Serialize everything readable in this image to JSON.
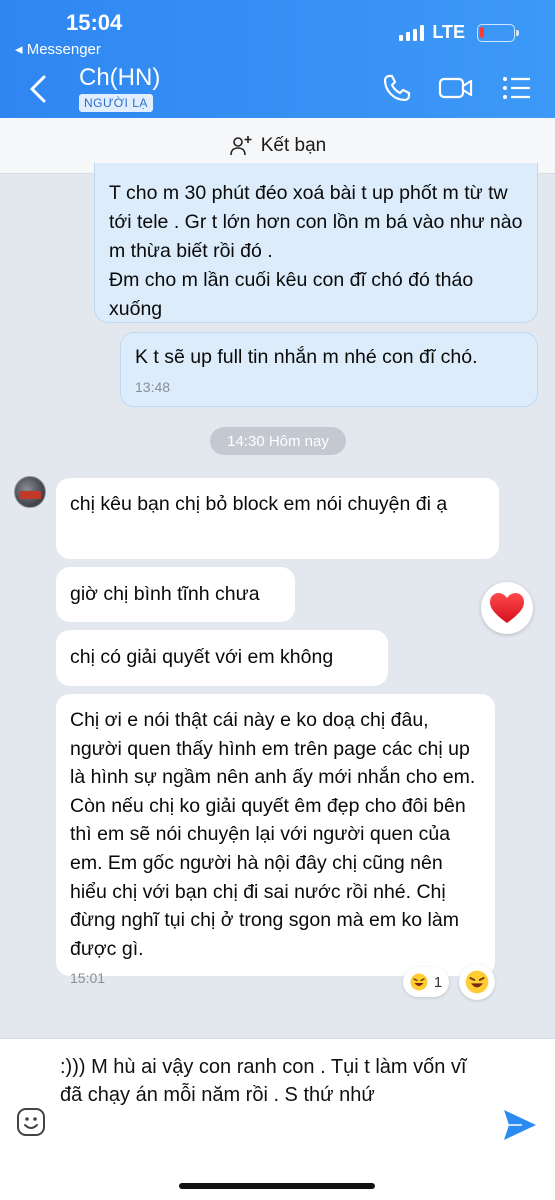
{
  "status_bar": {
    "time": "15:04",
    "back_app": "◂ Messenger",
    "network": "LTE",
    "battery_level": 0.1
  },
  "header": {
    "contact_name": "Ch(HN)",
    "badge": "NGƯỜI LẠ"
  },
  "add_friend": {
    "label": "Kết bạn"
  },
  "messages": [
    {
      "dir": "out",
      "text": "T cho m 30 phút đéo xoá bài t up phốt m từ tw tới tele . Gr t lớn hơn con lồn m bá vào như nào m thừa biết rồi đó .\nĐm cho m lần cuối kêu con đĩ chó đó tháo xuống"
    },
    {
      "dir": "out",
      "text": "K t sẽ up full tin nhắn m nhé con đĩ chó.",
      "time": "13:48"
    },
    {
      "dir": "in",
      "text": "chị kêu bạn chị bỏ block em nói chuyện đi ạ"
    },
    {
      "dir": "in",
      "text": "giờ chị bình tĩnh chưa"
    },
    {
      "dir": "in",
      "text": "chị có giải quyết với em không"
    },
    {
      "dir": "in",
      "text": "Chị ơi e nói thật cái này e ko doạ chị đâu, người quen thấy hình em trên page các chị up là hình sự ngầm nên anh ấy mới nhắn cho em. Còn nếu chị ko giải quyết êm đẹp cho đôi bên thì em sẽ nói chuyện lại với người quen của em. Em gốc người hà nội đây chị cũng nên hiểu chị với bạn chị đi sai nước rồi nhé. Chị đừng nghĩ tụi chị ở trong sgon mà em ko làm được gì.",
      "time": "15:01"
    }
  ],
  "separator": {
    "label": "14:30 Hôm nay"
  },
  "reactions": {
    "heart_icon": "heart-reaction",
    "laugh_icon": "laugh-reaction",
    "laugh_count": "1"
  },
  "composer": {
    "text": ":))) M hù ai vậy con ranh con . Tụi t làm vốn vĩ đã chạy án mỗi năm rồi . S thứ nhứ"
  },
  "colors": {
    "header": "#3d99f7",
    "accent": "#2a8cf0",
    "out_bubble": "#dcecfb",
    "chat_bg": "#e3e8ef"
  }
}
